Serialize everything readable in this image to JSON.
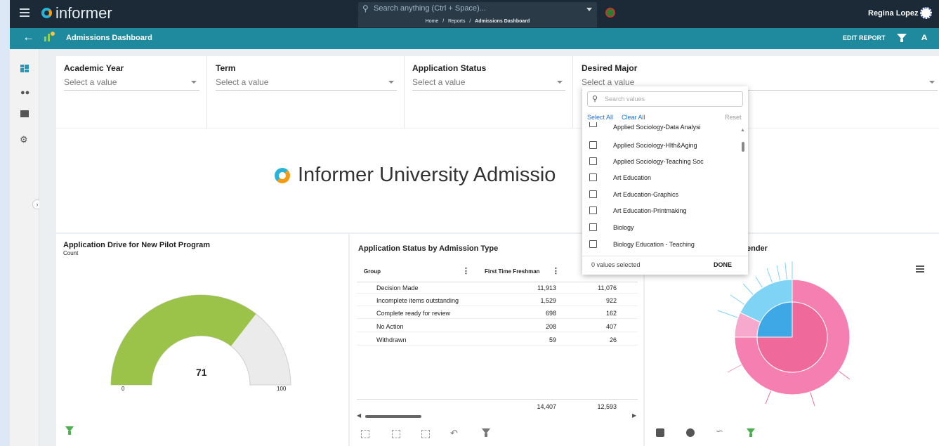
{
  "app": {
    "brand": "informer",
    "search_placeholder": "Search anything (Ctrl + Space)...",
    "breadcrumb": [
      "Home",
      "/",
      "Reports",
      "/",
      "Admissions Dashboard"
    ],
    "user": "Regina Lopez"
  },
  "nav": {
    "title": "Admissions Dashboard",
    "edit_report": "EDIT REPORT"
  },
  "filters": [
    {
      "label": "Academic Year",
      "placeholder": "Select a value"
    },
    {
      "label": "Term",
      "placeholder": "Select a value"
    },
    {
      "label": "Application Status",
      "placeholder": "Select a value"
    },
    {
      "label": "Desired Major",
      "placeholder": "Select a value"
    }
  ],
  "banner": {
    "title": "Informer University Admissio"
  },
  "dropdown": {
    "search_placeholder": "Search values",
    "select_all": "Select All",
    "clear_all": "Clear All",
    "reset": "Reset",
    "items": [
      "Applied Sociology-Data Analysi",
      "Applied Sociology-Hlth&Aging",
      "Applied Sociology-Teaching Soc",
      "Art Education",
      "Art Education-Graphics",
      "Art Education-Printmaking",
      "Biology",
      "Biology Education - Teaching"
    ],
    "status": "0 values selected",
    "done": "DONE"
  },
  "gauge_card": {
    "title": "Application Drive for New Pilot Program",
    "subtitle": "Count",
    "value_label": "71",
    "min_label": "0",
    "max_label": "100",
    "value": 71,
    "min": 0,
    "max": 100,
    "fill_color": "#9bc34a",
    "track_color": "#ebebeb"
  },
  "table_card": {
    "title": "Application Status by Admission Type",
    "header_group": "Group",
    "header_col1": "First Time Freshman",
    "rows": [
      {
        "group": "Decision Made",
        "c1": "11,913",
        "c2": "11,076"
      },
      {
        "group": "Incomplete items outstanding",
        "c1": "1,529",
        "c2": "922"
      },
      {
        "group": "Complete ready for review",
        "c1": "698",
        "c2": "162"
      },
      {
        "group": "No Action",
        "c1": "208",
        "c2": "407"
      },
      {
        "group": "Withdrawn",
        "c1": "59",
        "c2": "26"
      }
    ],
    "totals": {
      "c1": "14,407",
      "c2": "12,593"
    }
  },
  "sunburst_card": {
    "title_fragment": "ender",
    "colors": {
      "pink": "#ef6a9a",
      "pink_light": "#f7a8cd",
      "blue": "#3ea7e6",
      "cyan": "#7fd3f5"
    }
  }
}
